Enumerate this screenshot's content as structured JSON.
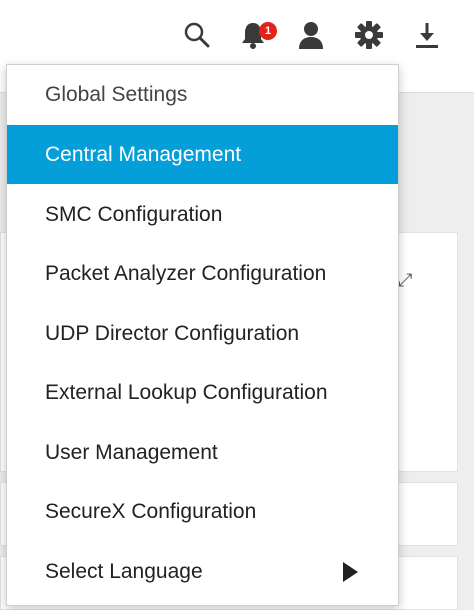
{
  "toolbar": {
    "notification_count": "1",
    "icons": [
      "search-icon",
      "bell-icon",
      "user-icon",
      "gear-icon",
      "download-icon"
    ]
  },
  "menu": {
    "header": "Global Settings",
    "items": [
      {
        "label": "Central Management",
        "active": true
      },
      {
        "label": "SMC Configuration"
      },
      {
        "label": "Packet Analyzer Configuration"
      },
      {
        "label": "UDP Director Configuration"
      },
      {
        "label": "External Lookup Configuration"
      },
      {
        "label": "User Management"
      },
      {
        "label": "SecureX Configuration"
      },
      {
        "label": "Select Language",
        "submenu": true
      }
    ]
  },
  "colors": {
    "accent": "#049fd9",
    "badge": "#e2231a",
    "icon": "#3a3a3a"
  }
}
